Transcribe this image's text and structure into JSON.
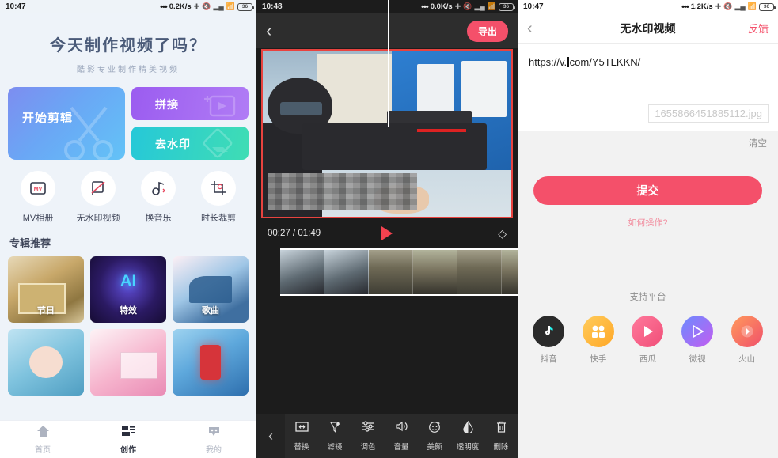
{
  "panels": {
    "home": {
      "statusbar": {
        "clock": "10:47",
        "speed": "0.2K/s",
        "battery": "36"
      },
      "hero": {
        "title": "今天制作视频了吗？",
        "subtitle": "酷影专业制作精美视频"
      },
      "big_buttons": [
        {
          "label": "开始剪辑",
          "icon": "scissors-icon"
        },
        {
          "label": "拼接",
          "icon": "merge-video-icon"
        },
        {
          "label": "去水印",
          "icon": "eraser-icon"
        }
      ],
      "features": [
        {
          "label": "MV相册",
          "icon": "mv-album-icon"
        },
        {
          "label": "无水印视频",
          "icon": "no-watermark-icon"
        },
        {
          "label": "换音乐",
          "icon": "music-note-icon"
        },
        {
          "label": "时长裁剪",
          "icon": "crop-duration-icon"
        }
      ],
      "section_title": "专辑推荐",
      "cards": [
        {
          "label": "节日",
          "theme": "gift"
        },
        {
          "label": "特效",
          "theme": "ai"
        },
        {
          "label": "歌曲",
          "theme": "piano"
        },
        {
          "label": "",
          "theme": "baby"
        },
        {
          "label": "",
          "theme": "flower"
        },
        {
          "label": "",
          "theme": "lantern"
        }
      ],
      "tabs": [
        {
          "label": "首页",
          "icon": "home-icon",
          "active": false
        },
        {
          "label": "创作",
          "icon": "create-icon",
          "active": true
        },
        {
          "label": "我的",
          "icon": "profile-icon",
          "active": false
        }
      ]
    },
    "editor": {
      "statusbar": {
        "clock": "10:48",
        "speed": "0.0K/s",
        "battery": "36"
      },
      "back_icon": "back-chevron-icon",
      "export_label": "导出",
      "time_current": "00:27",
      "time_total": "01:49",
      "time_display": "00:27 / 01:49",
      "play_icon": "play-icon",
      "ratio_icon": "aspect-ratio-icon",
      "tools": [
        {
          "label": "替换",
          "icon": "replace-icon"
        },
        {
          "label": "滤镜",
          "icon": "filter-icon"
        },
        {
          "label": "调色",
          "icon": "color-adjust-icon"
        },
        {
          "label": "音量",
          "icon": "volume-icon"
        },
        {
          "label": "美颜",
          "icon": "beauty-icon"
        },
        {
          "label": "透明度",
          "icon": "opacity-icon"
        },
        {
          "label": "删除",
          "icon": "trash-icon"
        }
      ],
      "tool_back_icon": "tools-back-chevron-icon"
    },
    "watermark": {
      "statusbar": {
        "clock": "10:47",
        "speed": "1.2K/s",
        "battery": "36"
      },
      "back_icon": "back-chevron-icon",
      "title": "无水印视频",
      "feedback_label": "反馈",
      "url_before_caret": "https://v.",
      "url_after_caret": "com/Y5TLKKN/",
      "filename": "1655866451885112.jpg",
      "clear_label": "清空",
      "submit_label": "提交",
      "help_label": "如何操作?",
      "platform_header": "支持平台",
      "platforms": [
        {
          "label": "抖音",
          "icon": "douyin-icon",
          "color": "#2b2b2b"
        },
        {
          "label": "快手",
          "icon": "kuaishou-icon",
          "color": "#ffa726"
        },
        {
          "label": "西瓜",
          "icon": "xigua-icon",
          "color": "#f04e78"
        },
        {
          "label": "微视",
          "icon": "weishi-icon",
          "color": "#8a6bf5"
        },
        {
          "label": "火山",
          "icon": "huoshan-icon",
          "color": "#f0506b"
        }
      ]
    }
  },
  "theme": {
    "accent_pink": "#f4506a",
    "home_bg": "#eef3f9",
    "editor_bg": "#1c1c1c",
    "watermark_bg": "#f2f2f2"
  }
}
